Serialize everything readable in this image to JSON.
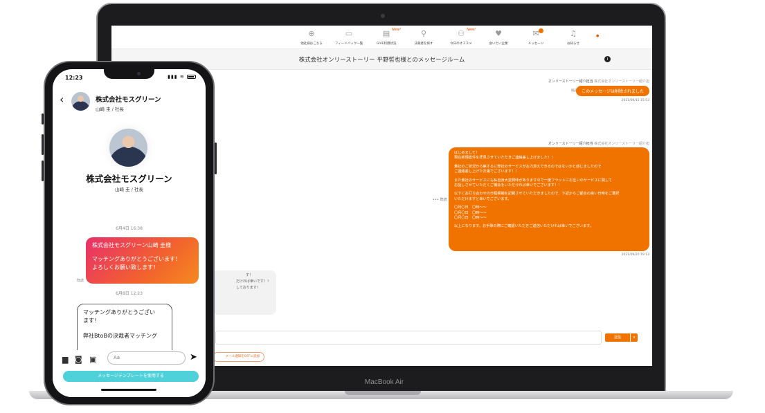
{
  "device_brand": "MacBook Air",
  "desktop": {
    "nav": [
      {
        "label": "他社様はこちら",
        "icon": "arrow-up-circle-icon"
      },
      {
        "label": "フィードバック一覧",
        "icon": "feedback-icon"
      },
      {
        "label": "GIVE利用状況",
        "icon": "clipboard-icon",
        "badge": "New!"
      },
      {
        "label": "決裁者を探す",
        "icon": "search-icon"
      },
      {
        "label": "今日のオススメ",
        "icon": "people-icon",
        "badge": "New!"
      },
      {
        "label": "会いたい企業",
        "icon": "heart-icon"
      },
      {
        "label": "メッセージ",
        "icon": "mail-icon"
      },
      {
        "label": "お知らせ",
        "icon": "bell-icon"
      }
    ],
    "room_title": "株式会社オンリーストーリー 平野哲也様とのメッセージルーム",
    "info_label": "i",
    "messages": [
      {
        "sender": "オンリーストーリー紹介担当",
        "sender_org": "株式会社オンリーストーリー紹介担",
        "read": "既読",
        "text": "このメッセージは削除されました",
        "time": "2021/09/15 15:53"
      },
      {
        "sender": "オンリーストーリー紹介担当",
        "sender_org": "株式会社オンリーストーリー紹介担",
        "read": "既読",
        "ellipsis": "•••",
        "time": "2021/09/20 19:13",
        "lines": [
          "はじめまして！",
          "現在新規案件を拝見させていただきご連絡差し上げました！！",
          "",
          "貴社のご状況から察するに弊社のサービスがお力添えできるのではないかと感じましたので",
          "ご連絡差し上げた次第でございます！！",
          "",
          "また貴社のサービスにも私自身大変興味がありますので一度フラットにお互いのサービスに関して",
          "お話しさせていただくご機会をいただければ幸いでございます！！",
          "",
          "以下にお打ち合わせの日程候補を記載させていただきましたので、下記からご都合の良い日時をご選択",
          "いただけますと幸いでございます。",
          "",
          "〇月〇日　〇時〜〜",
          "〇月〇日　〇時〜〜",
          "〇月〇日　〇時〜〜",
          "",
          "以上になります。お手隙の際にご確認いただきご返信いただければ幸いでございます。"
        ]
      }
    ],
    "partial_received": [
      "す！",
      "だければ幸いです！！",
      "",
      "しております！"
    ],
    "send_label": "送信",
    "dropdown_label": "▾",
    "mail_notice": "メール通知をOFFに追加"
  },
  "phone": {
    "time": "12:23",
    "company": "株式会社モスグリーン",
    "role": "山崎 圭 / 社長",
    "dates": [
      "6月4日 16:38",
      "6月8日 12:23"
    ],
    "sent_lines": [
      "株式会社モスグリーン山崎 圭様",
      "",
      "マッチングありがとうございます！",
      "よろしくお願い致します！"
    ],
    "read": "既読",
    "received_lines": [
      "マッチングありがとうござい",
      "ます！",
      "",
      "弊社BtoBの決裁者マッチング"
    ],
    "input_placeholder": "Aa",
    "template_button": "メッセージテンプレートを使用する"
  },
  "colors": {
    "accent": "#f07300",
    "template": "#4fd1d9"
  }
}
